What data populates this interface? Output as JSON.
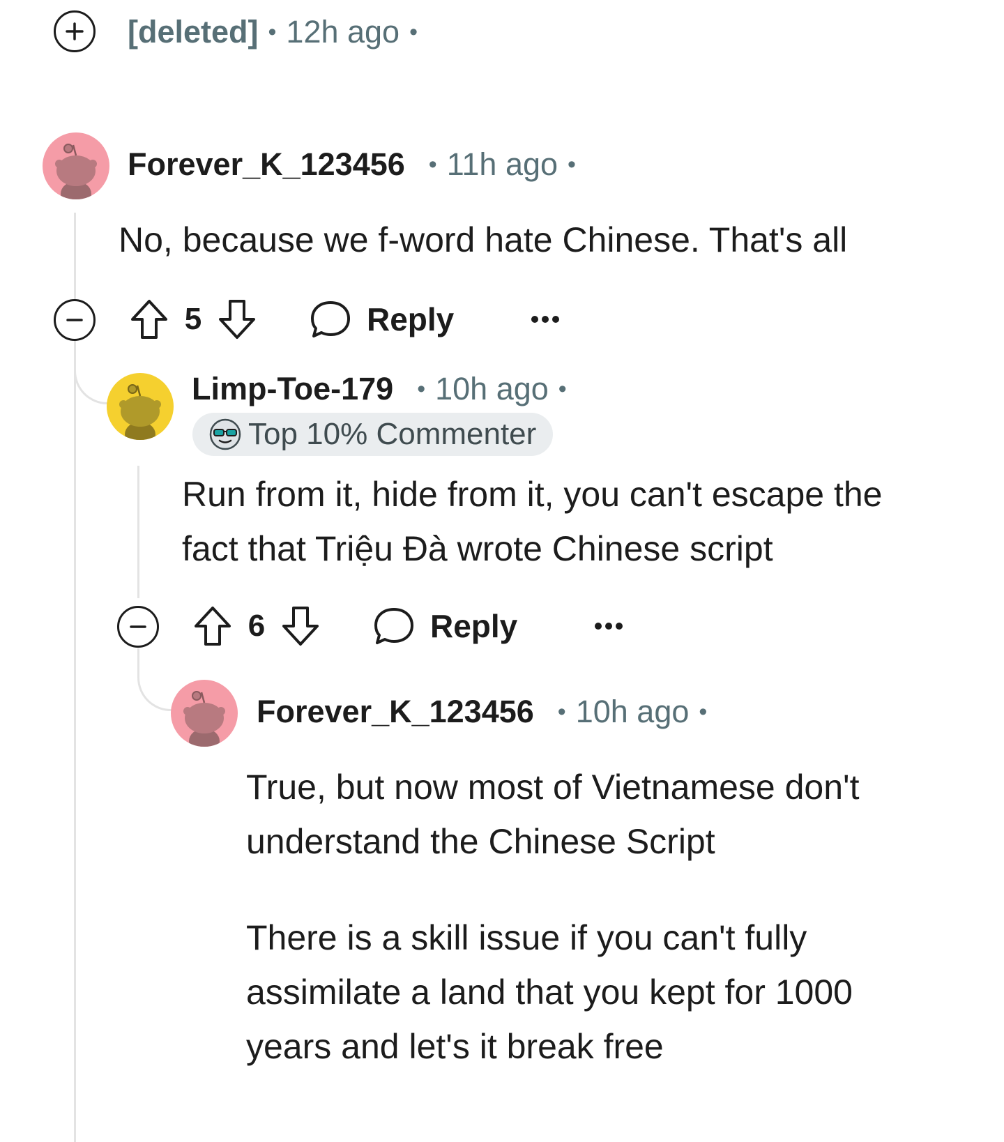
{
  "colors": {
    "text": "#1c1c1c",
    "meta": "#576f76",
    "thread": "#e3e3e3",
    "badge_bg": "#eaedef",
    "avatar_pink": "#f59ca7",
    "avatar_yellow": "#f5d02f"
  },
  "comments": [
    {
      "author": "[deleted]",
      "time": "12h ago",
      "collapsed": true,
      "expand_icon": "plus-icon"
    },
    {
      "author": "Forever_K_123456",
      "time": "11h ago",
      "avatar_icon": "snoo-avatar-pink",
      "body": [
        "No, because we f-word hate Chinese. That's all"
      ],
      "score": "5",
      "reply_label": "Reply",
      "more_label": "•••"
    },
    {
      "author": "Limp-Toe-179",
      "time": "10h ago",
      "avatar_icon": "snoo-avatar-yellow",
      "badge": {
        "icon": "sunglasses-icon",
        "label": "Top 10% Commenter"
      },
      "body": [
        "Run from it, hide from it, you can't escape the fact that Triệu Đà wrote Chinese script"
      ],
      "score": "6",
      "reply_label": "Reply",
      "more_label": "•••"
    },
    {
      "author": "Forever_K_123456",
      "time": "10h ago",
      "avatar_icon": "snoo-avatar-pink",
      "body": [
        "True, but now most of Vietnamese don't understand the Chinese Script",
        "There is a skill issue if you can't fully assimilate a land that you kept for 1000 years and let's it break free"
      ]
    }
  ],
  "separator": "•"
}
